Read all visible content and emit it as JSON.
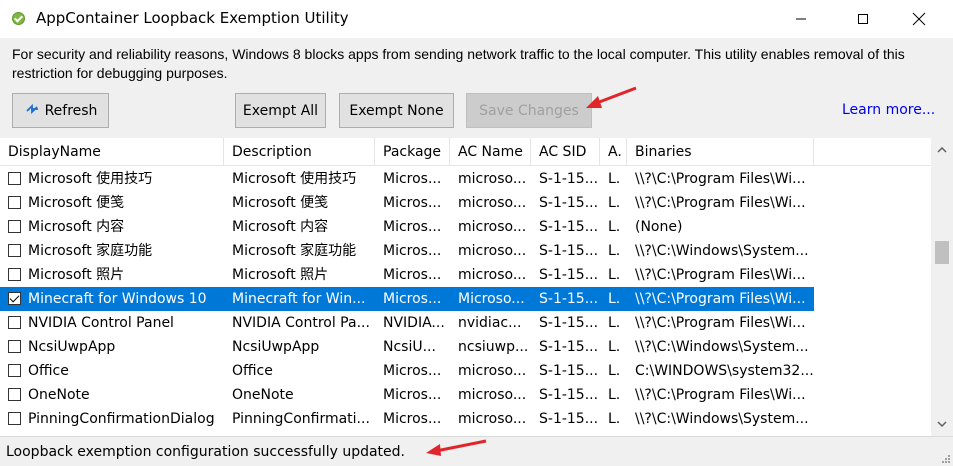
{
  "window": {
    "title": "AppContainer Loopback Exemption Utility",
    "app_icon": "green-check-icon",
    "controls": {
      "minimize": "minimize-icon",
      "maximize": "maximize-icon",
      "close": "close-icon"
    }
  },
  "description": "For security and reliability reasons, Windows 8 blocks apps from sending network traffic to the local computer. This utility enables removal of this restriction for debugging purposes.",
  "toolbar": {
    "refresh_label": "Refresh",
    "refresh_icon": "refresh-icon",
    "exempt_all_label": "Exempt All",
    "exempt_none_label": "Exempt None",
    "save_label": "Save Changes",
    "save_disabled": true,
    "learn_more": "Learn more..."
  },
  "table": {
    "columns": [
      "DisplayName",
      "Description",
      "Package",
      "AC Name",
      "AC SID",
      "A.",
      "Binaries"
    ],
    "rows": [
      {
        "checked": false,
        "cells": [
          "Microsoft 使用技巧",
          "Microsoft 使用技巧",
          "Micros...",
          "microso...",
          "S-1-15...",
          "L.",
          "\\\\?\\C:\\Program Files\\Wi..."
        ]
      },
      {
        "checked": false,
        "cells": [
          "Microsoft 便笺",
          "Microsoft 便笺",
          "Micros...",
          "microso...",
          "S-1-15...",
          "L.",
          "\\\\?\\C:\\Program Files\\Wi..."
        ]
      },
      {
        "checked": false,
        "cells": [
          "Microsoft 内容",
          "Microsoft 内容",
          "Micros...",
          "microso...",
          "S-1-15...",
          "L.",
          "(None)"
        ]
      },
      {
        "checked": false,
        "cells": [
          "Microsoft 家庭功能",
          "Microsoft 家庭功能",
          "Micros...",
          "microso...",
          "S-1-15...",
          "L.",
          "\\\\?\\C:\\Windows\\System..."
        ]
      },
      {
        "checked": false,
        "cells": [
          "Microsoft 照片",
          "Microsoft 照片",
          "Micros...",
          "microso...",
          "S-1-15...",
          "L.",
          "\\\\?\\C:\\Program Files\\Wi..."
        ]
      },
      {
        "checked": true,
        "selected": true,
        "cells": [
          "Minecraft for Windows 10",
          "Minecraft for Win...",
          "Micros...",
          "Microso...",
          "S-1-15...",
          "L.",
          "\\\\?\\C:\\Program Files\\Wi..."
        ]
      },
      {
        "checked": false,
        "cells": [
          "NVIDIA Control Panel",
          "NVIDIA Control Pa...",
          "NVIDIA...",
          "nvidiac...",
          "S-1-15...",
          "L.",
          "\\\\?\\C:\\Program Files\\Wi..."
        ]
      },
      {
        "checked": false,
        "cells": [
          "NcsiUwpApp",
          "NcsiUwpApp",
          "NcsiU...",
          "ncsiuwp...",
          "S-1-15...",
          "L.",
          "\\\\?\\C:\\Windows\\System..."
        ]
      },
      {
        "checked": false,
        "cells": [
          "Office",
          "Office",
          "Micros...",
          "microso...",
          "S-1-15...",
          "L.",
          "C:\\WINDOWS\\system32..."
        ]
      },
      {
        "checked": false,
        "cells": [
          "OneNote",
          "OneNote",
          "Micros...",
          "microso...",
          "S-1-15...",
          "L.",
          "\\\\?\\C:\\Program Files\\Wi..."
        ]
      },
      {
        "checked": false,
        "cells": [
          "PinningConfirmationDialog",
          "PinningConfirmati...",
          "Micros...",
          "microso...",
          "S-1-15...",
          "L.",
          "\\\\?\\C:\\Windows\\System..."
        ]
      }
    ]
  },
  "scrollbar": {
    "position": 0.35,
    "visible_fraction": 0.09
  },
  "status": {
    "text": "Loopback exemption configuration successfully updated."
  },
  "annotations": {
    "arrow_color": "#e0262b"
  },
  "colors": {
    "selection": "#0078d7",
    "link": "#0000ee",
    "check": "#7fb543"
  }
}
